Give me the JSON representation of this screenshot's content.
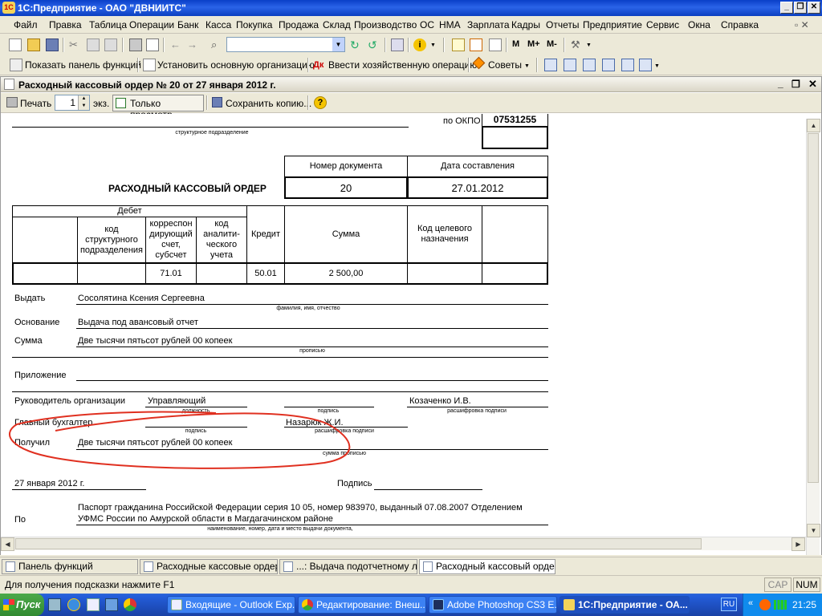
{
  "window": {
    "title": "1С:Предприятие - ОАО \"ДВНИИТС\"",
    "app_icon": "1C"
  },
  "menu": [
    "Файл",
    "Правка",
    "Таблица",
    "Операции",
    "Банк",
    "Касса",
    "Покупка",
    "Продажа",
    "Склад",
    "Производство",
    "ОС",
    "НМА",
    "Зарплата",
    "Кадры",
    "Отчеты",
    "Предприятие",
    "Сервис",
    "Окна",
    "Справка"
  ],
  "toolbar2": {
    "show_panel": "Показать панель функций",
    "set_org": "Установить основную организацию",
    "enter_op": "Ввести хозяйственную операцию",
    "tips": "Советы"
  },
  "toolbar1": {
    "m_buttons": [
      "M",
      "M+",
      "M-"
    ]
  },
  "document": {
    "title": "Расходный кассовый ордер № 20 от 27 января 2012 г.",
    "toolbar": {
      "print": "Печать",
      "copies": "1",
      "copies_unit": "экз.",
      "view_only": "Только просмотр",
      "save_copy": "Сохранить копию..."
    }
  },
  "form": {
    "okpo_label": "по ОКПО",
    "okpo": "07531255",
    "struct_unit_caption": "структурное подразделение",
    "doc_number_header": "Номер документа",
    "doc_date_header": "Дата составления",
    "title": "РАСХОДНЫЙ КАССОВЫЙ ОРДЕР",
    "doc_number": "20",
    "doc_date": "27.01.2012",
    "table": {
      "debit": "Дебет",
      "col_struct": "код структурного подразделения",
      "col_corr": "корреспон дирующий счет, субсчет",
      "col_analyt": "код аналити-ческого учета",
      "col_credit": "Кредит",
      "col_sum": "Сумма",
      "col_target": "Код целевого назначения",
      "row": {
        "corr": "71.01",
        "credit": "50.01",
        "sum": "2 500,00"
      }
    },
    "issue_label": "Выдать",
    "issue_value": "Сосолятина Ксения Сергеевна",
    "issue_caption": "фамилия, имя, отчество",
    "basis_label": "Основание",
    "basis_value": "Выдача под авансовый отчет",
    "sum_label": "Сумма",
    "sum_value": "Две тысячи пятьсот рублей 00 копеек",
    "sum_caption": "прописью",
    "attach_label": "Приложение",
    "head_label": "Руководитель организации",
    "head_position": "Управляющий",
    "position_caption": "должность",
    "signature_caption": "подпись",
    "head_name": "Козаченко И.В.",
    "decode_caption": "расшифровка подписи",
    "accountant_label": "Главный бухгалтер",
    "accountant_name": "Назарюк Ж.И.",
    "received_label": "Получил",
    "received_value": "Две тысячи пятьсот рублей 00 копеек",
    "received_caption": "сумма прописью",
    "date": "27 января 2012 г.",
    "sign_label": "Подпись",
    "by_label": "По",
    "passport_line1": "Паспорт гражданина Российской Федерации серия 10 05, номер 983970, выданный 07.08.2007 Отделением",
    "passport_line2": "УФМС России по Амурской области в Магдагачинском районе",
    "passport_caption": "наименование, номер, дата и место выдачи документа,"
  },
  "annotation_color": "#e03020",
  "bottom_tabs": [
    "Панель функций",
    "Расходные кассовые ордера",
    "...: Выдача подотчетному ли...",
    "Расходный кассовый орде..."
  ],
  "status": {
    "hint": "Для получения подсказки нажмите F1",
    "cap": "CAP",
    "num": "NUM"
  },
  "taskbar": {
    "start": "Пуск",
    "tasks": [
      "Входящие - Outlook Exp...",
      "Редактирование: Внеш...",
      "Adobe Photoshop CS3 E...",
      "1С:Предприятие - ОА..."
    ],
    "lang": "RU",
    "clock": "21:25"
  }
}
